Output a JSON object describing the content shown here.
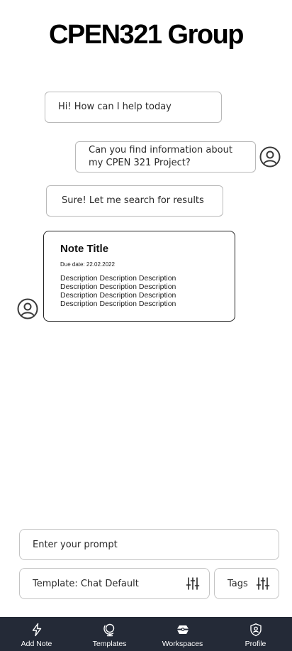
{
  "header": {
    "title": "CPEN321 Group"
  },
  "chat": {
    "messages": [
      {
        "sender": "bot",
        "text": "Hi! How can I help today"
      },
      {
        "sender": "user",
        "text": "Can you find information about my CPEN 321 Project?"
      },
      {
        "sender": "bot",
        "text": "Sure! Let me search for results"
      }
    ],
    "note_card": {
      "title": "Note Title",
      "due": "Due date: 22.02.2022",
      "description_lines": [
        "Description Description Description",
        "Description Description Description",
        "Description Description Description",
        "Description Description Description"
      ]
    }
  },
  "composer": {
    "prompt_placeholder": "Enter your prompt",
    "template_label": "Template: Chat Default",
    "tags_label": "Tags"
  },
  "bottom_nav": {
    "items": [
      {
        "label": "Add Note",
        "icon": "lightning-icon"
      },
      {
        "label": "Templates",
        "icon": "globe-stand-icon"
      },
      {
        "label": "Workspaces",
        "icon": "workspace-icon"
      },
      {
        "label": "Profile",
        "icon": "shield-user-icon"
      }
    ]
  },
  "colors": {
    "nav_background": "#242a37",
    "bubble_border": "#b9b9b9",
    "card_border": "#222222",
    "text": "#2a2a2a"
  }
}
